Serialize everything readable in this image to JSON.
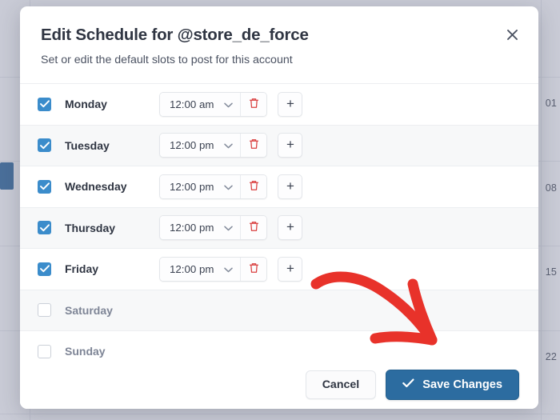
{
  "modal": {
    "title": "Edit Schedule for @store_de_force",
    "subtitle": "Set or edit the default slots to post for this account",
    "close_label": "×"
  },
  "rows": [
    {
      "day": "Monday",
      "enabled": true,
      "time": "12:00 am"
    },
    {
      "day": "Tuesday",
      "enabled": true,
      "time": "12:00 pm"
    },
    {
      "day": "Wednesday",
      "enabled": true,
      "time": "12:00 pm"
    },
    {
      "day": "Thursday",
      "enabled": true,
      "time": "12:00 pm"
    },
    {
      "day": "Friday",
      "enabled": true,
      "time": "12:00 pm"
    },
    {
      "day": "Saturday",
      "enabled": false,
      "time": ""
    },
    {
      "day": "Sunday",
      "enabled": false,
      "time": ""
    }
  ],
  "row_controls": {
    "add_label": "+",
    "delete_icon": "trash-icon",
    "chevron_icon": "chevron-down-icon"
  },
  "footer": {
    "cancel_label": "Cancel",
    "save_label": "Save Changes",
    "save_check_icon": "check-icon"
  },
  "background": {
    "day_numbers": [
      "01",
      "08",
      "15",
      "22"
    ]
  },
  "colors": {
    "accent_blue": "#3b8ccb",
    "save_blue": "#2c6ca0",
    "trash_red": "#d93f3f",
    "arrow_red": "#e8322a",
    "backdrop": "#c9cbd6",
    "row_alt": "#f7f8f9"
  }
}
